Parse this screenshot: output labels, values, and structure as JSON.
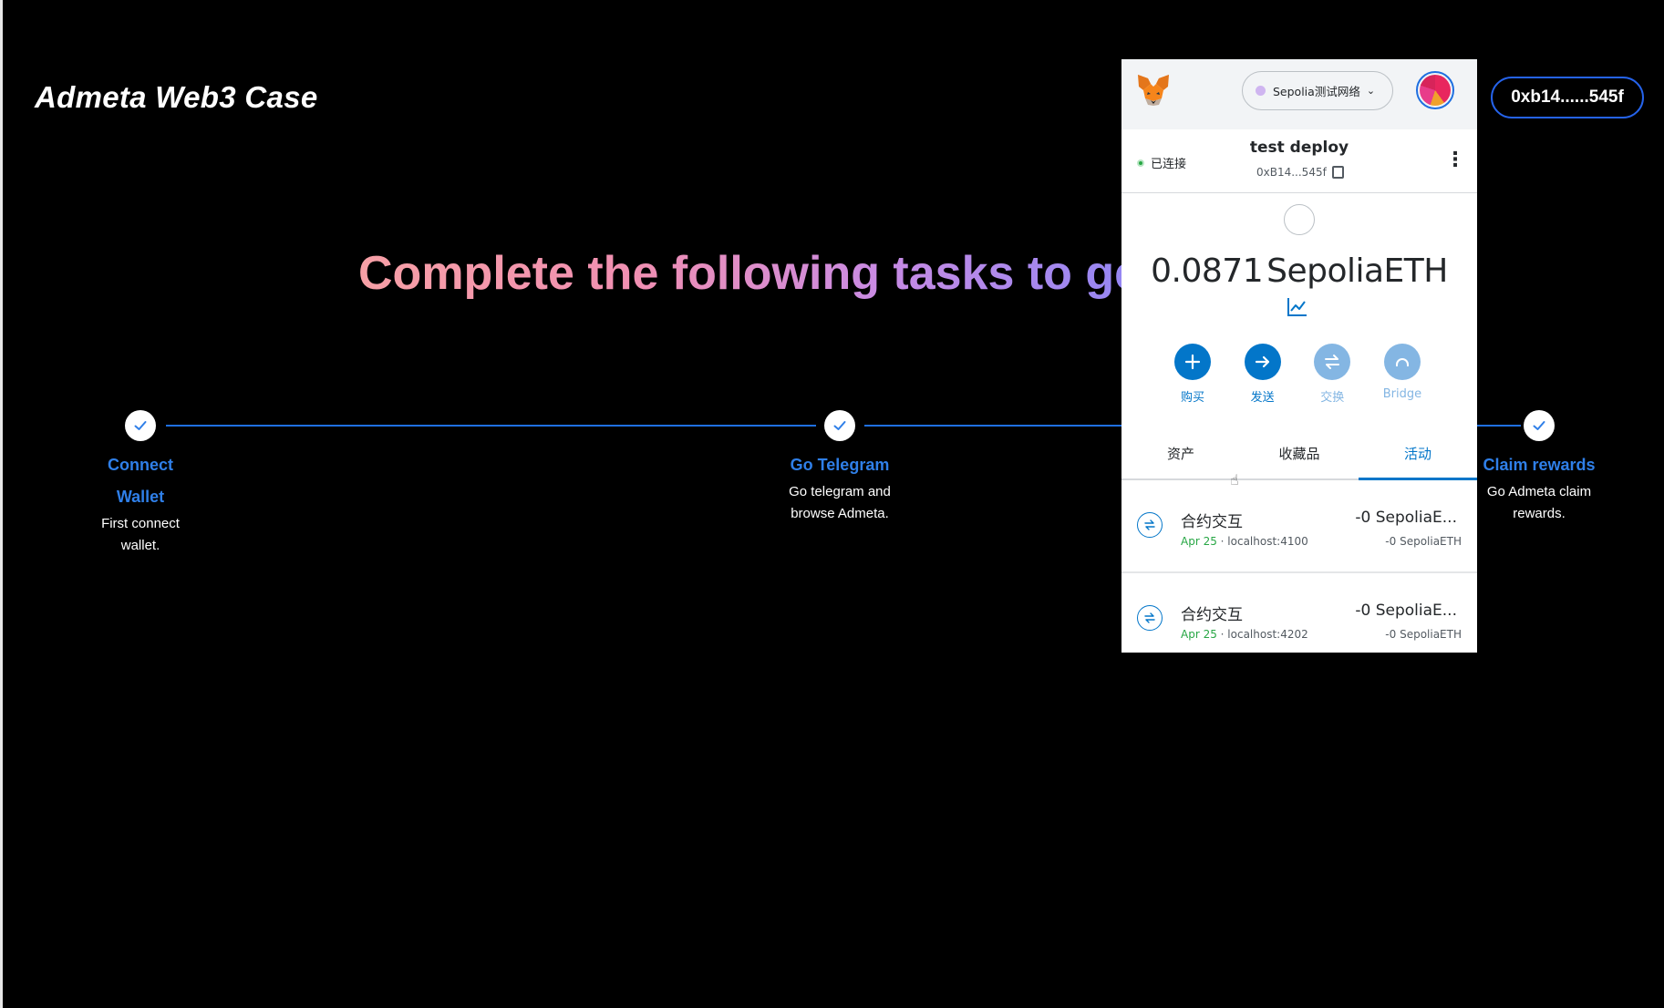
{
  "app": {
    "brand": "Admeta Web3 Case",
    "wallet_button": "0xb14......545f"
  },
  "hero": {
    "headline": "Complete the following tasks to get"
  },
  "steps": [
    {
      "title_line1": "Connect",
      "title_line2": "Wallet",
      "desc_line1": "First connect",
      "desc_line2": "wallet.",
      "done": true
    },
    {
      "title_line1": "Go Telegram",
      "desc_line1": "Go telegram and",
      "desc_line2": "browse Admeta.",
      "done": true
    },
    {
      "title_line1": "Claim rewards",
      "desc_line1": "Go Admeta claim",
      "desc_line2": "rewards.",
      "done": true
    }
  ],
  "metamask": {
    "network": "Sepolia测试网络",
    "connection_status": "已连接",
    "account_name": "test deploy",
    "account_address": "0xB14...545f",
    "balance": "0.0871",
    "balance_unit": "SepoliaETH",
    "actions": [
      {
        "label": "购买",
        "icon": "plus-icon",
        "enabled": true
      },
      {
        "label": "发送",
        "icon": "arrow-right-icon",
        "enabled": true
      },
      {
        "label": "交换",
        "icon": "swap-icon",
        "enabled": false
      },
      {
        "label": "Bridge",
        "icon": "bridge-icon",
        "enabled": false
      }
    ],
    "tabs": [
      {
        "label": "资产",
        "active": false
      },
      {
        "label": "收藏品",
        "active": false
      },
      {
        "label": "活动",
        "active": true
      }
    ],
    "activity": [
      {
        "title": "合约交互",
        "date": "Apr 25",
        "origin": "localhost:4100",
        "amount": "-0 SepoliaE...",
        "amount_sub": "-0 SepoliaETH"
      },
      {
        "title": "合约交互",
        "date": "Apr 25",
        "origin": "localhost:4202",
        "amount": "-0 SepoliaE...",
        "amount_sub": "-0 SepoliaETH"
      }
    ],
    "colors": {
      "primary": "#0376c9",
      "success": "#28a745"
    }
  },
  "colors": {
    "step_accent": "#2f7fe8",
    "step_line": "#1f6fe0",
    "wallet_border": "#2563eb"
  }
}
